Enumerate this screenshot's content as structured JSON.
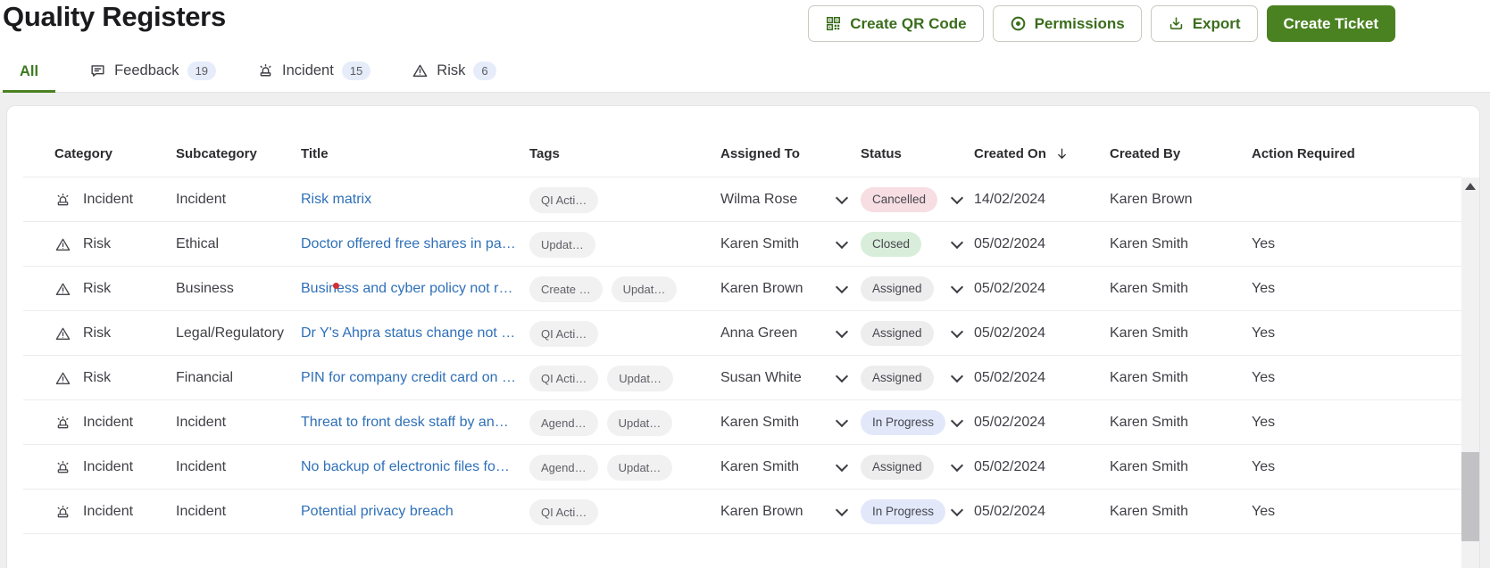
{
  "page": {
    "title": "Quality Registers"
  },
  "toolbar": {
    "create_qr_label": "Create QR Code",
    "permissions_label": "Permissions",
    "export_label": "Export",
    "create_ticket_label": "Create Ticket"
  },
  "tabs": {
    "all": {
      "label": "All"
    },
    "feedback": {
      "label": "Feedback",
      "count": "19"
    },
    "incident": {
      "label": "Incident",
      "count": "15"
    },
    "risk": {
      "label": "Risk",
      "count": "6"
    }
  },
  "table": {
    "columns": [
      "Category",
      "Subcategory",
      "Title",
      "Tags",
      "Assigned To",
      "Status",
      "Created On",
      "Created By",
      "Action Required"
    ],
    "sort": {
      "column": "Created On",
      "direction": "desc"
    },
    "rows": [
      {
        "category": "Incident",
        "category_icon": "incident",
        "subcategory": "Incident",
        "title": "Risk matrix",
        "indicator": false,
        "tags": [
          "QI Acti…"
        ],
        "assigned_to": "Wilma Rose",
        "status": "Cancelled",
        "status_color": "red",
        "created_on": "14/02/2024",
        "created_by": "Karen Brown",
        "action_required": ""
      },
      {
        "category": "Risk",
        "category_icon": "risk",
        "subcategory": "Ethical",
        "title": "Doctor offered free shares in pa…",
        "indicator": false,
        "tags": [
          "Updat…"
        ],
        "assigned_to": "Karen Smith",
        "status": "Closed",
        "status_color": "green",
        "created_on": "05/02/2024",
        "created_by": "Karen Smith",
        "action_required": "Yes"
      },
      {
        "category": "Risk",
        "category_icon": "risk",
        "subcategory": "Business",
        "title": "Business and cyber policy not r…",
        "indicator": true,
        "tags": [
          "Create …",
          "Updat…"
        ],
        "assigned_to": "Karen Brown",
        "status": "Assigned",
        "status_color": "gray",
        "created_on": "05/02/2024",
        "created_by": "Karen Smith",
        "action_required": "Yes"
      },
      {
        "category": "Risk",
        "category_icon": "risk",
        "subcategory": "Legal/Regulatory",
        "title": "Dr Y's Ahpra status change not …",
        "indicator": false,
        "tags": [
          "QI Acti…"
        ],
        "assigned_to": "Anna Green",
        "status": "Assigned",
        "status_color": "gray",
        "created_on": "05/02/2024",
        "created_by": "Karen Smith",
        "action_required": "Yes"
      },
      {
        "category": "Risk",
        "category_icon": "risk",
        "subcategory": "Financial",
        "title": "PIN for company credit card on …",
        "indicator": false,
        "tags": [
          "QI Acti…",
          "Updat…"
        ],
        "assigned_to": "Susan White",
        "status": "Assigned",
        "status_color": "gray",
        "created_on": "05/02/2024",
        "created_by": "Karen Smith",
        "action_required": "Yes"
      },
      {
        "category": "Incident",
        "category_icon": "incident",
        "subcategory": "Incident",
        "title": "Threat to front desk staff by an…",
        "indicator": false,
        "tags": [
          "Agend…",
          "Updat…"
        ],
        "assigned_to": "Karen Smith",
        "status": "In Progress",
        "status_color": "blue",
        "created_on": "05/02/2024",
        "created_by": "Karen Smith",
        "action_required": "Yes"
      },
      {
        "category": "Incident",
        "category_icon": "incident",
        "subcategory": "Incident",
        "title": "No backup of electronic files fo…",
        "indicator": false,
        "tags": [
          "Agend…",
          "Updat…"
        ],
        "assigned_to": "Karen Smith",
        "status": "Assigned",
        "status_color": "gray",
        "created_on": "05/02/2024",
        "created_by": "Karen Smith",
        "action_required": "Yes"
      },
      {
        "category": "Incident",
        "category_icon": "incident",
        "subcategory": "Incident",
        "title": "Potential privacy breach",
        "indicator": false,
        "tags": [
          "QI Acti…"
        ],
        "assigned_to": "Karen Brown",
        "status": "In Progress",
        "status_color": "blue",
        "created_on": "05/02/2024",
        "created_by": "Karen Smith",
        "action_required": "Yes"
      }
    ]
  },
  "colors": {
    "primary_green": "#4a8221",
    "green_text": "#3a6d1d",
    "link_blue": "#2f70b8",
    "badge_red_bg": "#f7dee3",
    "badge_green_bg": "#d9eeda",
    "badge_gray_bg": "#ededee",
    "badge_blue_bg": "#e2e8fa",
    "tag_pill_bg": "#f1f1f2",
    "tab_count_bg": "#e6ecf9",
    "page_bg": "#efeff0",
    "indicator_red": "#d22f33"
  }
}
